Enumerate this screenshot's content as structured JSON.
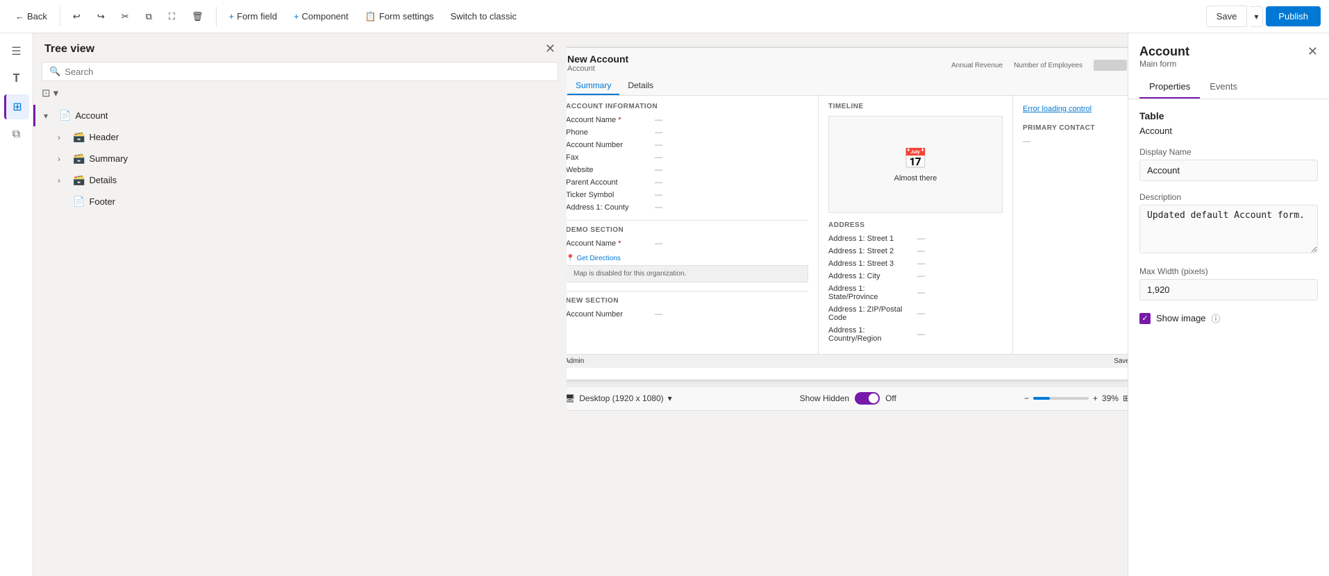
{
  "toolbar": {
    "back_label": "Back",
    "form_field_label": "Form field",
    "component_label": "Component",
    "form_settings_label": "Form settings",
    "switch_label": "Switch to classic",
    "save_label": "Save",
    "publish_label": "Publish"
  },
  "sidebar": {
    "title": "Tree view",
    "search_placeholder": "Search",
    "items": [
      {
        "id": "account",
        "label": "Account",
        "level": 0,
        "expanded": true,
        "icon": "📄"
      },
      {
        "id": "header",
        "label": "Header",
        "level": 1,
        "expanded": false,
        "icon": "🗃️"
      },
      {
        "id": "summary",
        "label": "Summary",
        "level": 1,
        "expanded": false,
        "icon": "🗃️"
      },
      {
        "id": "details",
        "label": "Details",
        "level": 1,
        "expanded": false,
        "icon": "🗃️"
      },
      {
        "id": "footer",
        "label": "Footer",
        "level": 1,
        "expanded": false,
        "icon": "📄"
      }
    ]
  },
  "canvas": {
    "form": {
      "title": "New Account",
      "subtitle": "Account",
      "tabs": [
        "Summary",
        "Details"
      ],
      "active_tab": "Summary",
      "section_account_info": "ACCOUNT INFORMATION",
      "fields": [
        {
          "label": "Account Name",
          "required": true,
          "value": "—"
        },
        {
          "label": "Phone",
          "value": "—"
        },
        {
          "label": "Account Number",
          "value": "—"
        },
        {
          "label": "Fax",
          "value": "—"
        },
        {
          "label": "Website",
          "value": "—"
        },
        {
          "label": "Parent Account",
          "value": "—"
        },
        {
          "label": "Ticker Symbol",
          "value": "—"
        },
        {
          "label": "Address 1: County",
          "value": "—"
        }
      ],
      "demo_section": "Demo Section",
      "demo_fields": [
        {
          "label": "Account Name",
          "required": true,
          "value": "—"
        }
      ],
      "new_section": "New Section",
      "new_fields": [
        {
          "label": "Account Number",
          "value": "—"
        }
      ],
      "timeline_label": "Timeline",
      "almost_there": "Almost there",
      "error_loading": "Error loading control",
      "primary_contact": "Primary Contact",
      "address_section": "ADDRESS",
      "address_fields": [
        {
          "label": "Address 1: Street 1",
          "value": "—"
        },
        {
          "label": "Address 1: Street 2",
          "value": "—"
        },
        {
          "label": "Address 1: Street 3",
          "value": "—"
        },
        {
          "label": "Address 1: City",
          "value": "—"
        },
        {
          "label": "Address 1: State/Province",
          "value": "—"
        },
        {
          "label": "Address 1: ZIP/Postal Code",
          "value": "—"
        },
        {
          "label": "Address 1: Country/Region",
          "value": "—"
        }
      ],
      "get_directions": "Get Directions",
      "map_disabled": "Map is disabled for this organization.",
      "footer_action": "Admin",
      "footer_save": "Save",
      "header_controls": [
        "Annual Revenue",
        "Number of Employees"
      ]
    },
    "footer": {
      "desktop_label": "Desktop (1920 x 1080)",
      "show_hidden_label": "Show Hidden",
      "toggle_state": "Off",
      "zoom_label": "39%"
    }
  },
  "right_panel": {
    "title": "Account",
    "subtitle": "Main form",
    "close_icon": "✕",
    "tabs": [
      "Properties",
      "Events"
    ],
    "active_tab": "Properties",
    "table_section": "Table",
    "table_value": "Account",
    "display_name_label": "Display Name",
    "display_name_value": "Account",
    "description_label": "Description",
    "description_value": "Updated default Account form.",
    "max_width_label": "Max Width (pixels)",
    "max_width_value": "1,920",
    "show_image_label": "Show image",
    "info_icon": "ⓘ"
  }
}
